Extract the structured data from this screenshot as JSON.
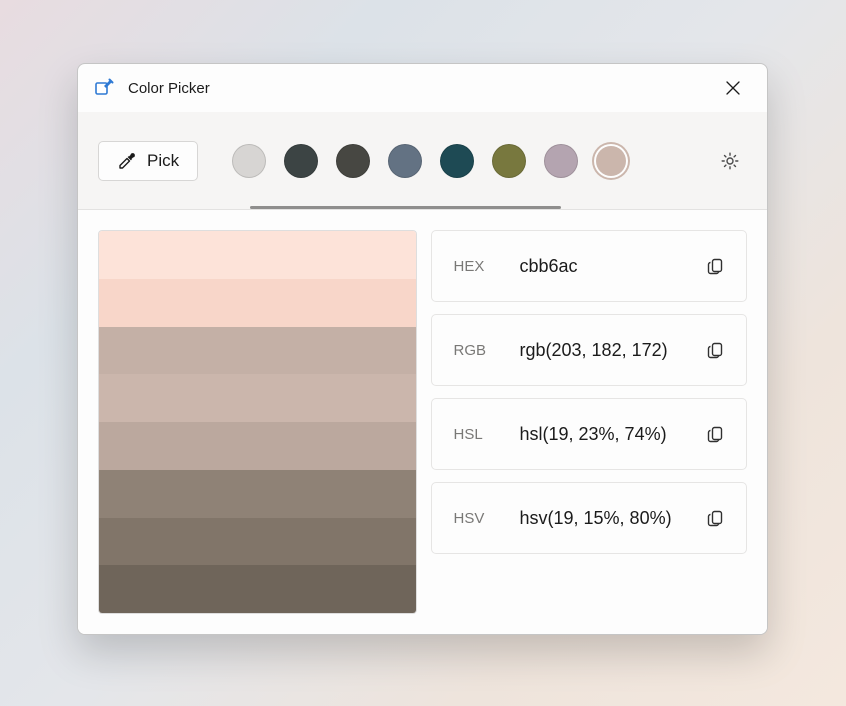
{
  "title": "Color Picker",
  "pick_label": "Pick",
  "history": [
    {
      "color": "#d7d5d3",
      "selected": false
    },
    {
      "color": "#3c4444",
      "selected": false
    },
    {
      "color": "#474742",
      "selected": false
    },
    {
      "color": "#637283",
      "selected": false
    },
    {
      "color": "#1e4a54",
      "selected": false
    },
    {
      "color": "#78783e",
      "selected": false
    },
    {
      "color": "#b4a4b0",
      "selected": false
    },
    {
      "color": "#cbb6ac",
      "selected": true
    }
  ],
  "shades": [
    "#fde3d9",
    "#f8d6c9",
    "#c4b0a6",
    "#cbb6ac",
    "#bba89e",
    "#8f8276",
    "#817569",
    "#6f655a"
  ],
  "formats": [
    {
      "label": "HEX",
      "value": "cbb6ac"
    },
    {
      "label": "RGB",
      "value": "rgb(203, 182, 172)"
    },
    {
      "label": "HSL",
      "value": "hsl(19, 23%, 74%)"
    },
    {
      "label": "HSV",
      "value": "hsv(19, 15%, 80%)"
    }
  ]
}
